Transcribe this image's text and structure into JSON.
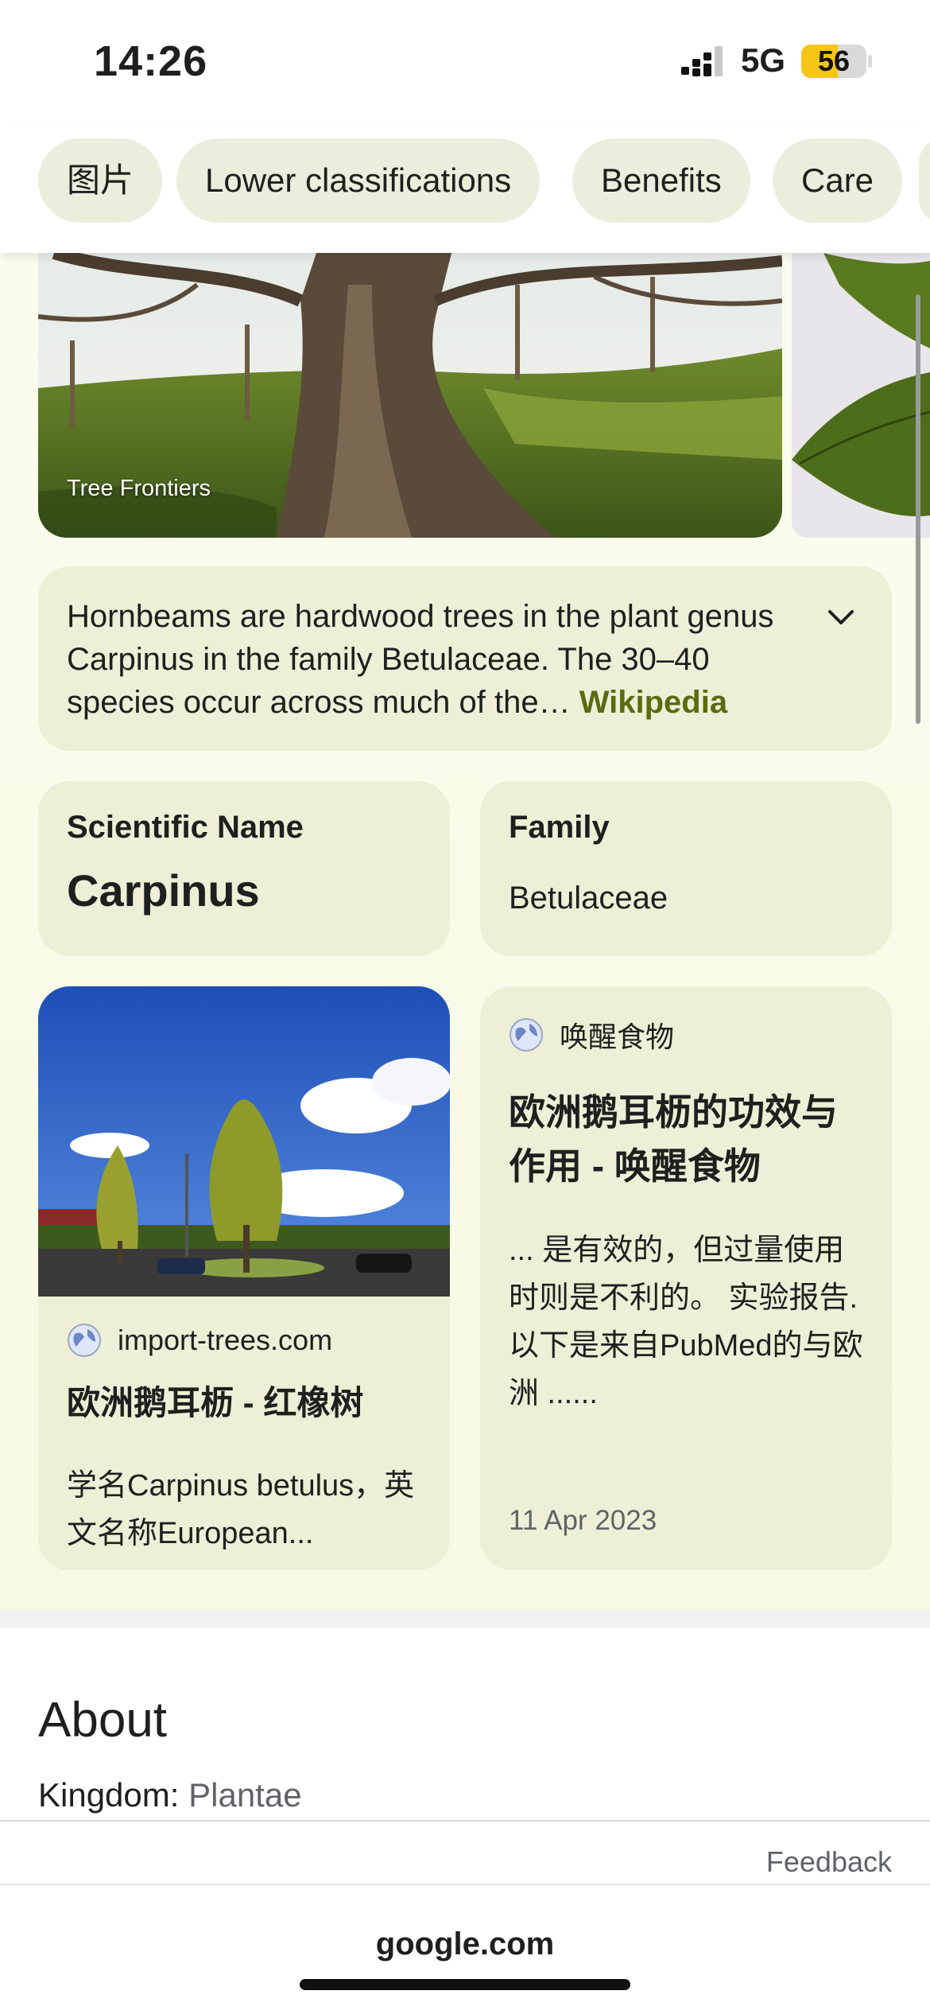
{
  "status_bar": {
    "time": "14:26",
    "network": "5G",
    "battery": "56",
    "battery_level": 0.56
  },
  "chips": [
    "图片",
    "Lower classifications",
    "Benefits",
    "Care"
  ],
  "image_strip": {
    "caption": "Tree Frontiers"
  },
  "description": {
    "text": "Hornbeams are hardwood trees in the plant genus Carpinus in the family Betulaceae. The 30–40 species occur across much of the",
    "ellipsis": "…",
    "source": "Wikipedia"
  },
  "facts": {
    "scientific_name_label": "Scientific Name",
    "scientific_name": "Carpinus",
    "family_label": "Family",
    "family": "Betulaceae"
  },
  "cards": [
    {
      "site": "import-trees.com",
      "title": "欧洲鹅耳枥 - 红橡树",
      "snippet": "学名Carpinus betulus，英文名称European..."
    },
    {
      "site": "唤醒食物",
      "title": "欧洲鹅耳枥的功效与作用 - 唤醒食物",
      "snippet": "... 是有效的，但过量使用时则是不利的。 实验报告. 以下是来自PubMed的与欧洲 ......",
      "date": "11 Apr 2023"
    }
  ],
  "about": {
    "title": "About",
    "kingdom_label": "Kingdom:",
    "kingdom_value": "Plantae"
  },
  "feedback": "Feedback",
  "url": "google.com",
  "colors": {
    "accent": "#5c6a10",
    "card_bg": "#edf0d6",
    "chip_bg": "#eceedd"
  }
}
